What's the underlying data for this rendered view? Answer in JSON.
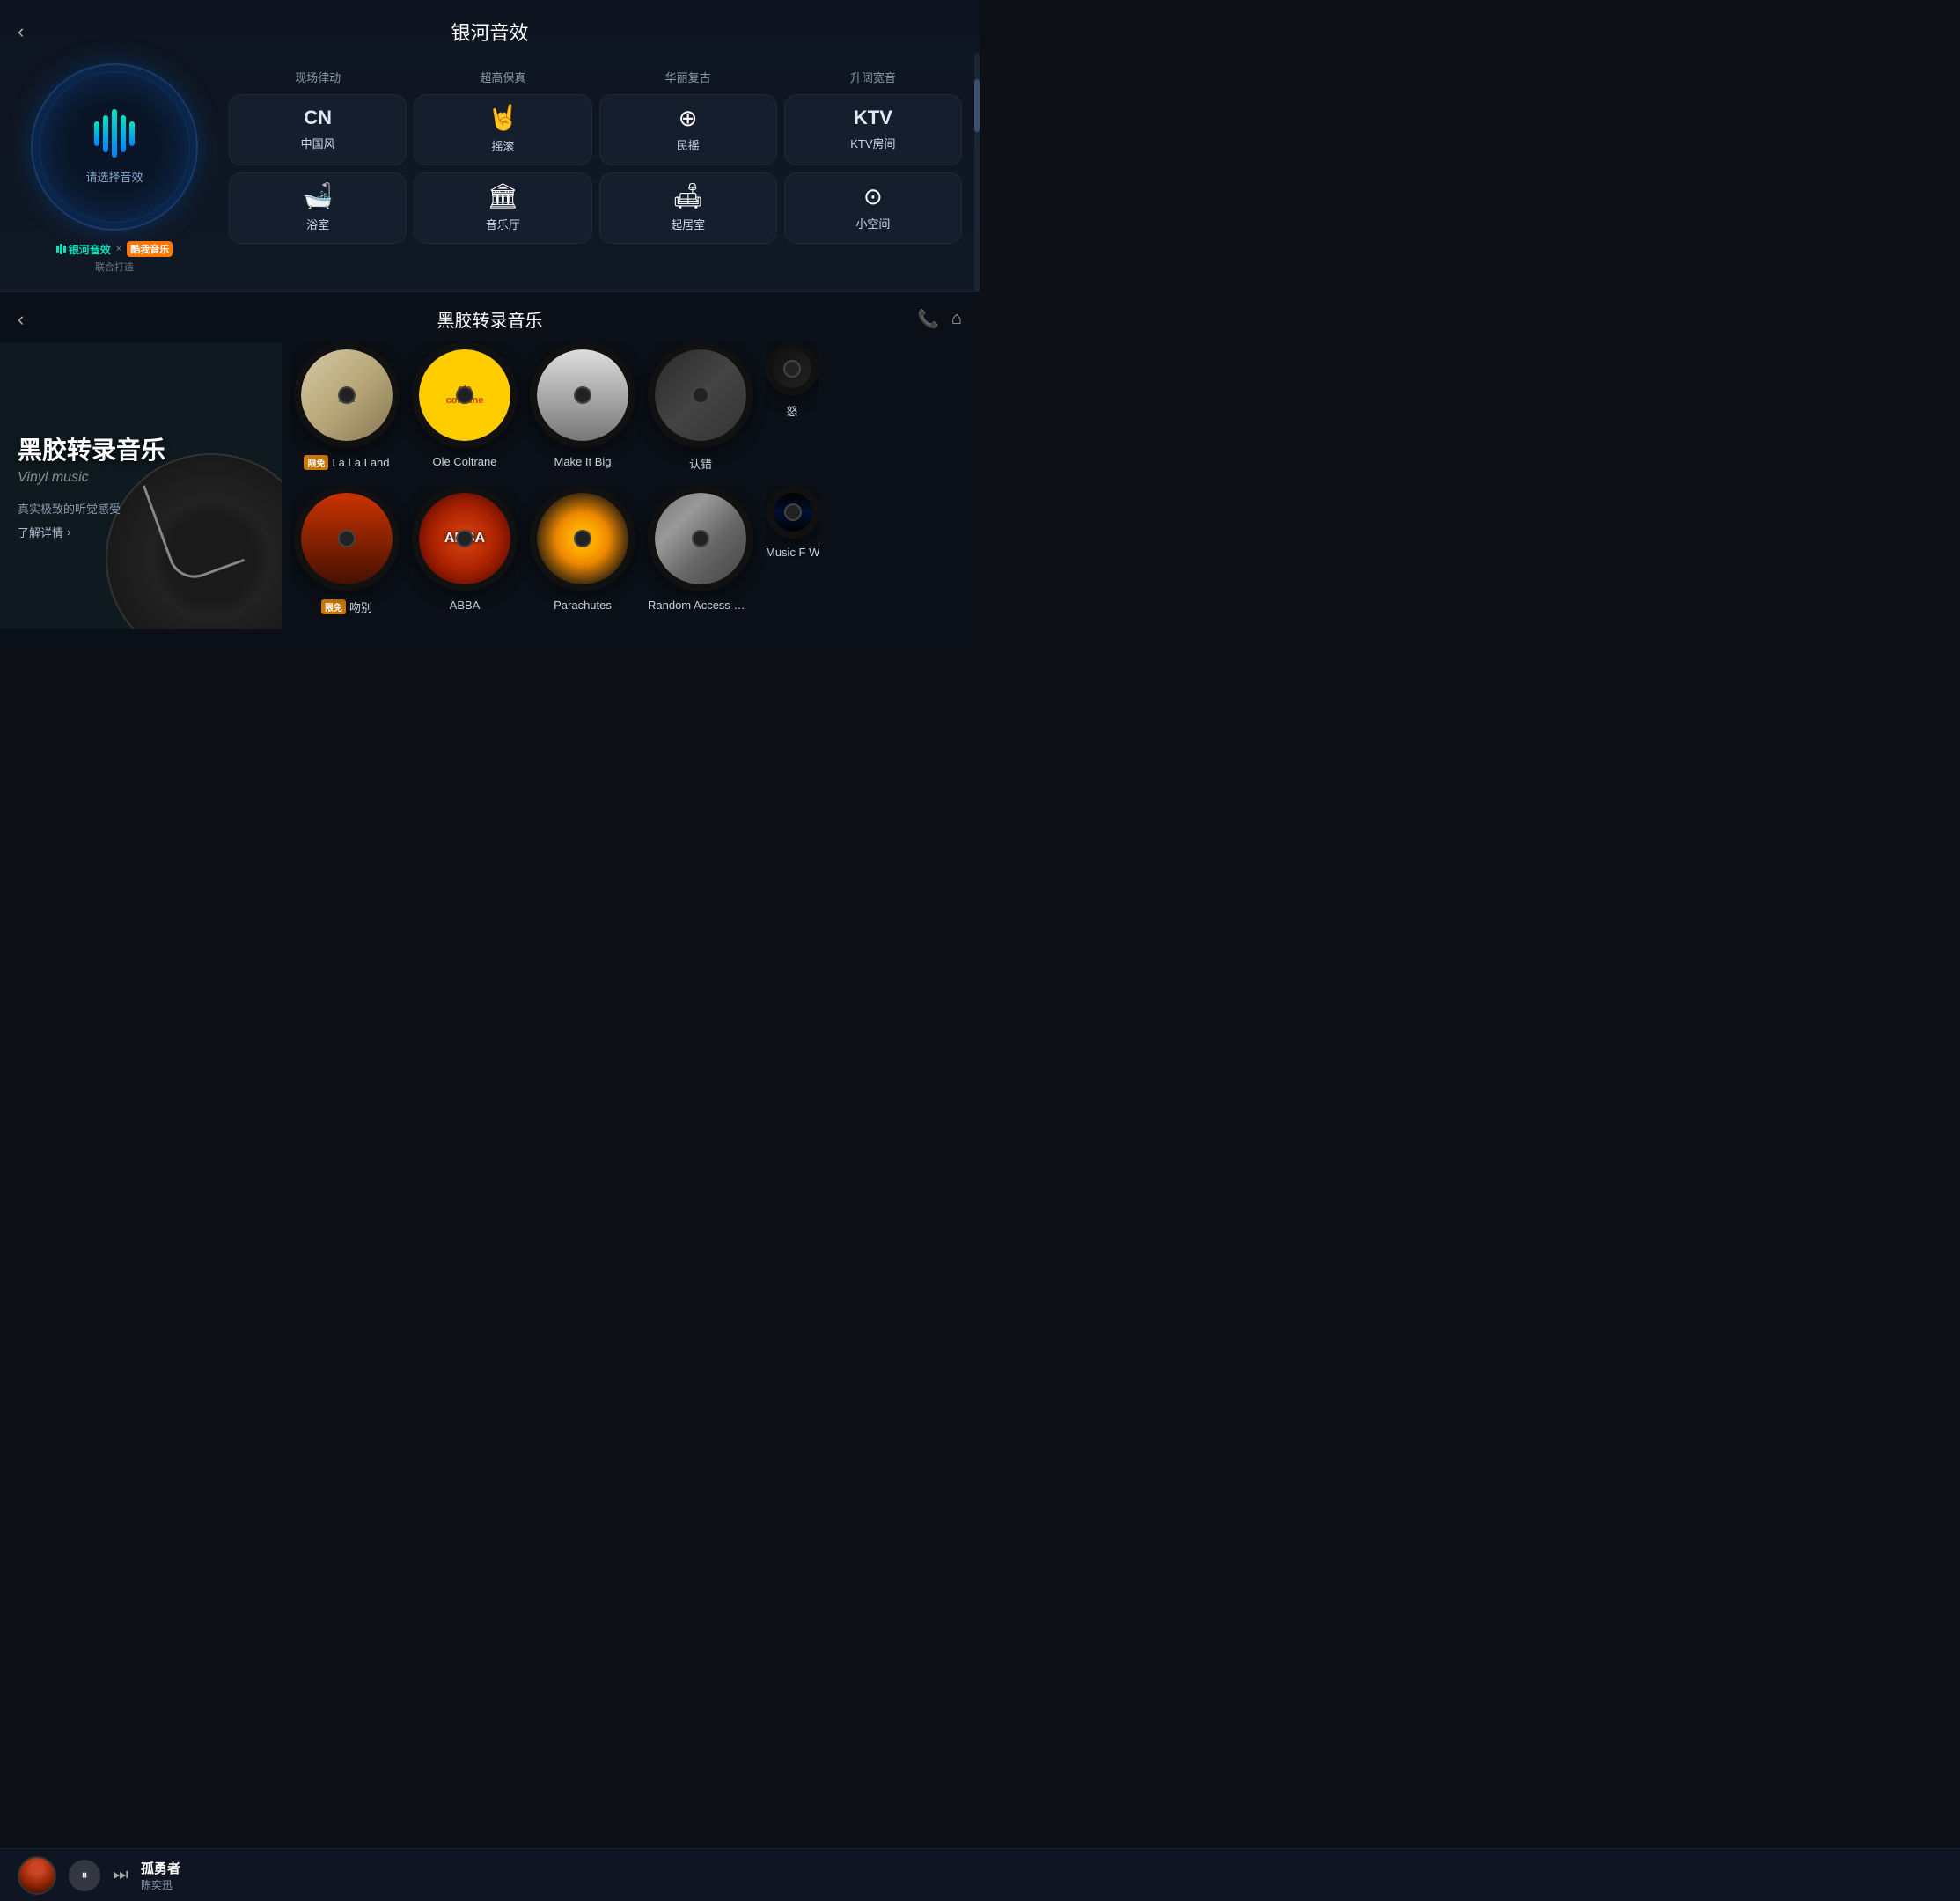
{
  "top_section": {
    "title": "银河音效",
    "back_label": "‹",
    "visualizer": {
      "label": "请选择音效"
    },
    "brand": {
      "logo_text": "银河音效",
      "cross": "×",
      "kw_text": "酷我音乐",
      "sub": "联合打造"
    },
    "effects_top_labels": [
      "现场律动",
      "超高保真",
      "华丽复古",
      "升阔宽音"
    ],
    "effects_rows": [
      [
        {
          "icon": "CN",
          "label": "中国风",
          "type": "text"
        },
        {
          "icon": "✌",
          "label": "摇滚",
          "type": "emoji"
        },
        {
          "icon": "⊕",
          "label": "民摇",
          "type": "symbol"
        },
        {
          "icon": "KTV",
          "label": "KTV房间",
          "type": "text"
        }
      ],
      [
        {
          "icon": "🛁",
          "label": "浴室",
          "type": "emoji"
        },
        {
          "icon": "🏛",
          "label": "音乐厅",
          "type": "emoji"
        },
        {
          "icon": "🛋",
          "label": "起居室",
          "type": "emoji"
        },
        {
          "icon": "⊙",
          "label": "小空间",
          "type": "symbol"
        }
      ]
    ]
  },
  "bottom_section": {
    "title": "黑胶转录音乐",
    "back_label": "‹",
    "phone_icon": "📞",
    "home_icon": "⌂",
    "vinyl_panel": {
      "title": "黑胶转录音乐",
      "subtitle": "Vinyl music",
      "desc": "真实极致的听觉感受",
      "more": "了解详情",
      "more_arrow": "›"
    },
    "albums_row1": [
      {
        "name": "La La Land",
        "tag": "限免",
        "art": "laland"
      },
      {
        "name": "Ole Coltrane",
        "tag": "",
        "art": "coltrane"
      },
      {
        "name": "Make It Big",
        "tag": "",
        "art": "makeitbig"
      },
      {
        "name": "认错",
        "tag": "",
        "art": "rencuo"
      },
      {
        "name": "怒",
        "tag": "",
        "art": "nu",
        "partial": true
      }
    ],
    "albums_row2": [
      {
        "name": "吻别",
        "tag": "限免",
        "art": "person"
      },
      {
        "name": "ABBA",
        "tag": "",
        "art": "abba"
      },
      {
        "name": "Parachutes",
        "tag": "",
        "art": "parachutes"
      },
      {
        "name": "Random Access Mem",
        "tag": "",
        "art": "ram"
      },
      {
        "name": "Music F W",
        "tag": "",
        "art": "starwars",
        "partial": true
      }
    ]
  },
  "now_playing": {
    "track": "孤勇者",
    "artist": "陈奕迅",
    "pause_icon": "⏸",
    "next_icon": "⏭"
  }
}
